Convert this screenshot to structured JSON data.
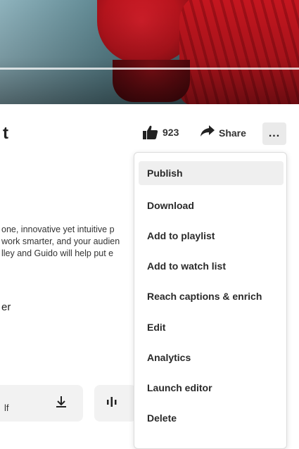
{
  "header": {
    "title_fragment": "t",
    "likes": {
      "count": "923"
    },
    "share_label": "Share",
    "more_label": "..."
  },
  "description": {
    "lines": [
      "one, innovative yet intuitive p",
      "work smarter, and your audien",
      "lley and Guido will help put e"
    ],
    "fragment": "er"
  },
  "bottom_actions": {
    "download_text_fragment": "lf"
  },
  "menu": {
    "items": [
      {
        "label": "Publish",
        "active": true
      },
      {
        "label": "Download"
      },
      {
        "label": "Add to playlist"
      },
      {
        "label": "Add to watch list"
      },
      {
        "label": "Reach captions & enrich"
      },
      {
        "label": "Edit"
      },
      {
        "label": "Analytics"
      },
      {
        "label": "Launch editor"
      },
      {
        "label": "Delete"
      }
    ]
  },
  "icons": {
    "like": "thumbs-up-icon",
    "share": "share-arrow-icon",
    "more": "more-dots-icon",
    "download": "download-icon",
    "audio": "audio-waveform-icon"
  }
}
